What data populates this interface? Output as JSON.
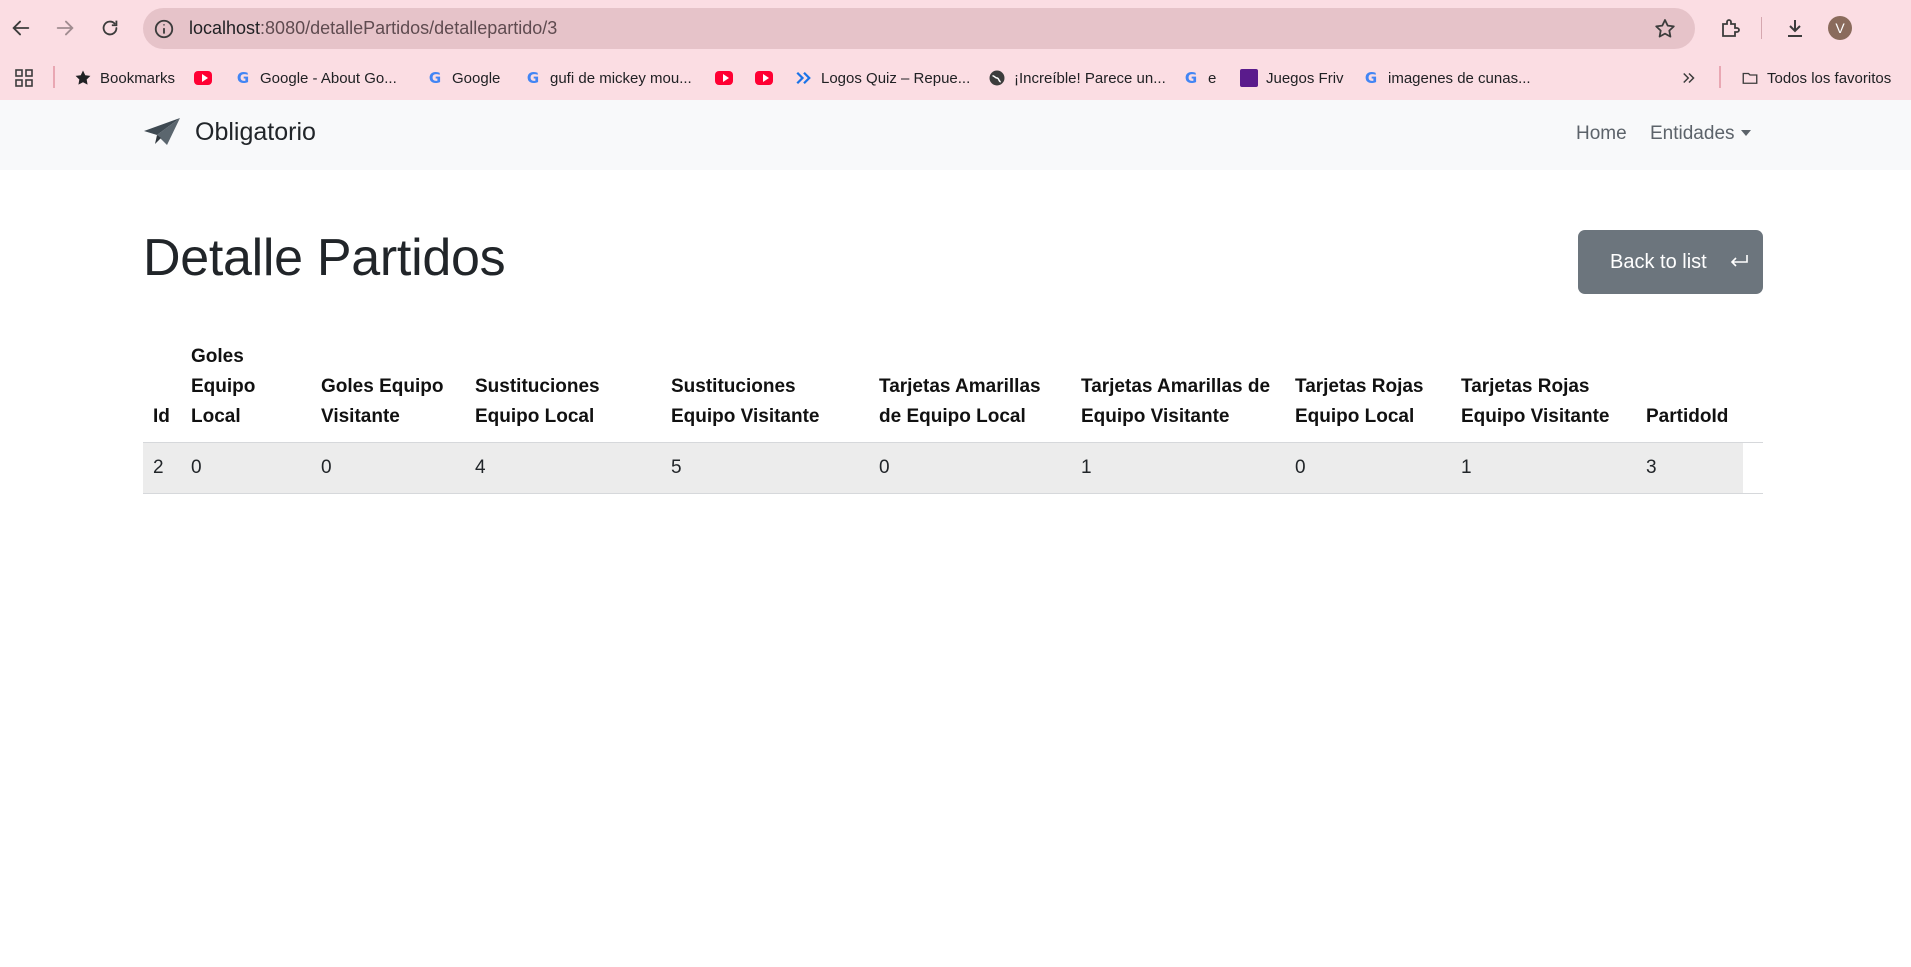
{
  "browser": {
    "url_host": "localhost",
    "url_path": ":8080/detallePartidos/detallepartido/3",
    "avatar_initial": "V",
    "bookmarks": [
      {
        "label": "Bookmarks",
        "icon": "star-icon"
      },
      {
        "label": "",
        "icon": "youtube-icon"
      },
      {
        "label": "Google - About Go...",
        "icon": "google-icon"
      },
      {
        "label": "Google",
        "icon": "google-icon"
      },
      {
        "label": "gufi de mickey mou...",
        "icon": "google-icon"
      },
      {
        "label": "",
        "icon": "youtube-icon"
      },
      {
        "label": "",
        "icon": "youtube-icon"
      },
      {
        "label": "Logos Quiz – Repue...",
        "icon": "chevrons-icon"
      },
      {
        "label": "¡Increíble! Parece un...",
        "icon": "globe-icon"
      },
      {
        "label": "e",
        "icon": "google-icon"
      },
      {
        "label": "Juegos Friv",
        "icon": "friv-icon"
      },
      {
        "label": "imagenes de cunas...",
        "icon": "google-icon"
      }
    ],
    "all_bookmarks_label": "Todos los favoritos"
  },
  "navbar": {
    "brand": "Obligatorio",
    "home": "Home",
    "entities": "Entidades"
  },
  "page": {
    "title": "Detalle Partidos",
    "back_label": "Back to list"
  },
  "table": {
    "headers": [
      "Id",
      "Goles Equipo Local",
      "Goles Equipo Visitante",
      "Sustituciones Equipo Local",
      "Sustituciones Equipo Visitante",
      "Tarjetas Amarillas de Equipo Local",
      "Tarjetas Amarillas de Equipo Visitante",
      "Tarjetas Rojas Equipo Local",
      "Tarjetas Rojas Equipo Visitante",
      "PartidoId"
    ],
    "rows": [
      [
        "2",
        "0",
        "0",
        "4",
        "5",
        "0",
        "1",
        "0",
        "1",
        "3"
      ]
    ]
  },
  "colors": {
    "chrome": "#fbdde3",
    "omnibox": "#e6c3c9",
    "navbar": "#f8f9fa",
    "button": "#6c757d",
    "row": "#ececec"
  }
}
